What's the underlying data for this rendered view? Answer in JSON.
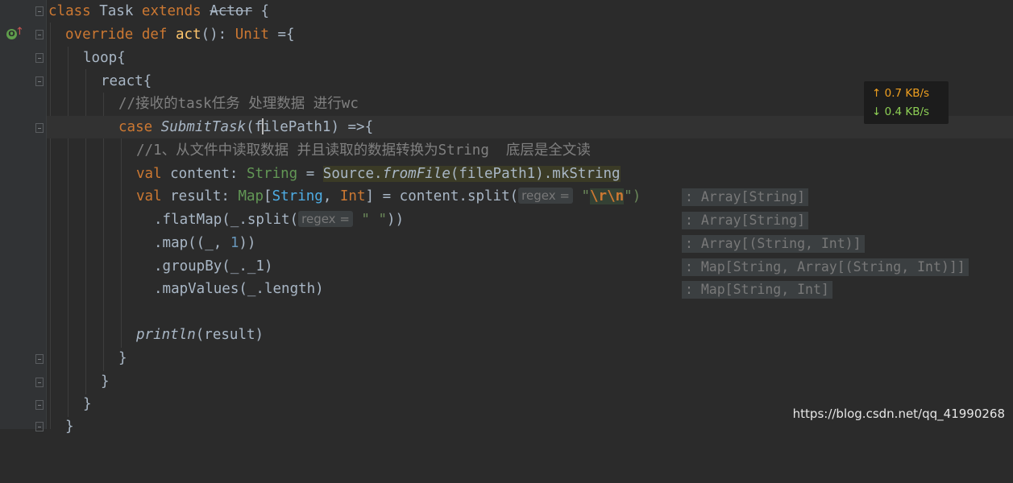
{
  "code": {
    "l1": {
      "kw1": "class",
      "name": " Task ",
      "kw2": "extends",
      "parent": "Actor",
      "brace": " {"
    },
    "l2": {
      "kw1": "override",
      "kw2": " def ",
      "fn": "act",
      "paren": "(): ",
      "type": "Unit",
      "rest": " ={"
    },
    "l3": {
      "text": "loop{"
    },
    "l4": {
      "text": "react{"
    },
    "l5": {
      "text": "//接收的task任务 处理数据 进行wc"
    },
    "l6": {
      "kw": "case",
      "cls": " SubmitTask",
      "open": "(f",
      "arg": "ilePath1",
      "close": ") =>{"
    },
    "l7": {
      "text": "//1、从文件中读取数据 并且读取的数据转换为String  底层是全文读"
    },
    "l8": {
      "kw": "val",
      "name": " content: ",
      "type": "String",
      "eq": " = ",
      "src": "Source.",
      "fn": "fromFile",
      "args": "(filePath1)",
      "tail": ".mkString"
    },
    "l9": {
      "kw": "val",
      "name": " result: ",
      "map": "Map",
      "ob": "[",
      "t1": "String",
      "comma": ", ",
      "t2": "Int",
      "cb": "]",
      "eq": " = content.split(",
      "hint": "regex =",
      "q1": " \"",
      "esc": "\\r\\n",
      "q2": "\")",
      "type_hint": ": Array[String]"
    },
    "l10": {
      "pre": ".flatMap(_.split(",
      "hint": "regex =",
      "str": " \" \"",
      "post": "))",
      "type_hint": ": Array[String]"
    },
    "l11": {
      "pre": ".map((_, ",
      "num": "1",
      "post": "))",
      "type_hint": ": Array[(String, Int)]"
    },
    "l12": {
      "text": ".groupBy(_._1)",
      "type_hint": ": Map[String, Array[(String, Int)]]"
    },
    "l13": {
      "text": ".mapValues(_.length)",
      "type_hint": ": Map[String, Int]"
    },
    "l15": {
      "fn": "println",
      "args": "(result)"
    },
    "l16": {
      "text": "}"
    },
    "l17": {
      "text": "}"
    },
    "l18": {
      "text": "}"
    },
    "l19": {
      "text": "}"
    }
  },
  "gutter": {
    "override_icon": "override-icon",
    "bulb_icon": "bulb-icon"
  },
  "speed_widget": {
    "up_arrow": "↑",
    "up": "0.7 KB/s",
    "down_arrow": "↓",
    "down": "0.4 KB/s"
  },
  "watermark": "https://blog.csdn.net/qq_41990268",
  "colors": {
    "background": "#2b2b2b",
    "keyword": "#cc7832",
    "function": "#ffc66d",
    "comment": "#808080",
    "string": "#6a8759",
    "number": "#6897bb"
  }
}
